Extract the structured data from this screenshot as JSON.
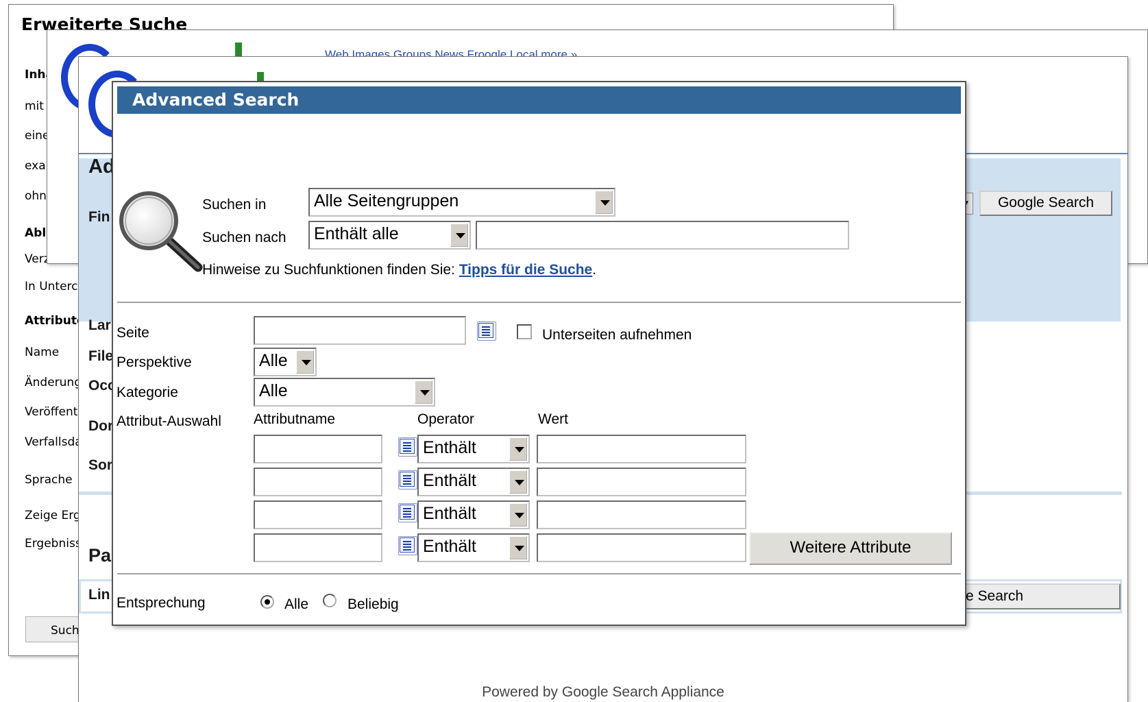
{
  "back_window": {
    "title": "Erweiterte Suche",
    "labels": [
      "Inha",
      "mit",
      "eine",
      "exa",
      "ohn",
      "Abl",
      "Verzeichn",
      "In Unterc",
      "Attribute",
      "Name",
      "Änderung",
      "Veröffent",
      "Verfallsda",
      "Sprache",
      "Zeige Erg",
      "Ergebniss"
    ],
    "search_button": "Such"
  },
  "middle_window": {
    "tabs": "Web    Images    Groups    News    Froogle    Local    more »"
  },
  "google_page": {
    "title": "Ad",
    "find_label": "Fin",
    "side_labels": [
      "Lar",
      "File",
      "Occ",
      "Dor",
      "Sor"
    ],
    "pages_title": "Pa",
    "links_label": "Lin",
    "google_search_button": "Google Search",
    "google_search_button_2": "e Search",
    "powered_by": "Powered by Google Search Appliance"
  },
  "dialog": {
    "title": "Advanced Search",
    "search_in_label": "Suchen in",
    "search_in_value": "Alle Seitengruppen",
    "search_for_label": "Suchen nach",
    "search_for_value": "Enthält alle",
    "search_for_text": "",
    "hint_text": "Hinweise zu Suchfunktionen finden Sie: ",
    "hint_link": "Tipps für die Suche",
    "hint_period": ".",
    "page_label": "Seite",
    "page_value": "",
    "include_subpages": "Unterseiten aufnehmen",
    "perspective_label": "Perspektive",
    "perspective_value": "Alle",
    "category_label": "Kategorie",
    "category_value": "Alle",
    "attribute_selection_label": "Attribut-Auswahl",
    "col_attribute_name": "Attributname",
    "col_operator": "Operator",
    "col_value": "Wert",
    "attribute_rows": [
      {
        "name": "",
        "operator": "Enthält",
        "value": ""
      },
      {
        "name": "",
        "operator": "Enthält",
        "value": ""
      },
      {
        "name": "",
        "operator": "Enthält",
        "value": ""
      },
      {
        "name": "",
        "operator": "Enthält",
        "value": ""
      }
    ],
    "more_attributes_button": "Weitere Attribute",
    "match_label": "Entsprechung",
    "match_options": [
      {
        "label": "Alle",
        "selected": true
      },
      {
        "label": "Beliebig",
        "selected": false
      }
    ]
  },
  "colors": {
    "dialog_header": "#336699",
    "link": "#1f4f9c",
    "panel_band": "#cfe0f0"
  }
}
